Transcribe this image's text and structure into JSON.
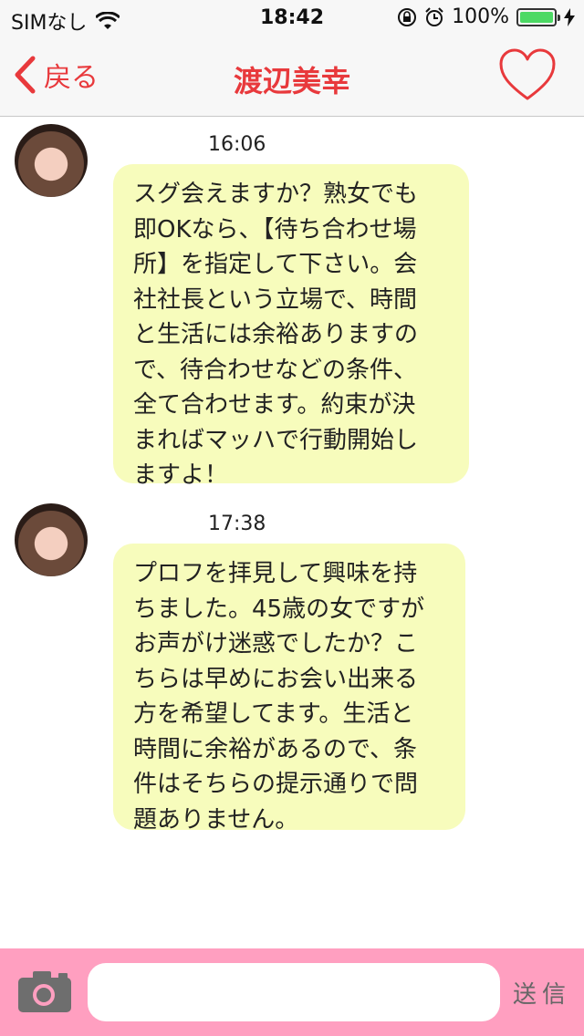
{
  "status_bar": {
    "carrier": "SIMなし",
    "time": "18:42",
    "battery_percent": "100%",
    "battery_level": 1.0,
    "icons": [
      "wifi-icon",
      "rotation-lock-icon",
      "alarm-icon",
      "battery-icon",
      "charging-icon"
    ]
  },
  "nav": {
    "back_label": "戻る",
    "title": "渡辺美幸",
    "accent_color": "#e8393c"
  },
  "messages": [
    {
      "time": "16:06",
      "lines": [
        "スグ会えますか？熟女でも",
        "即OKなら、【待ち合わせ場",
        "所】を指定して下さい。会",
        "社社長という立場で、時間",
        "と生活には余裕ありますの",
        "で、待合わせなどの条件、",
        "全て合わせます。約束が決",
        "まればマッハで行動開始し",
        "ますよ！"
      ]
    },
    {
      "time": "17:38",
      "lines": [
        "プロフを拝見して興味を持",
        "ちました。45歳の女ですが",
        "お声がけ迷惑でしたか？こ",
        "ちらは早めにお会い出来る",
        "方を希望してます。生活と",
        "時間に余裕があるので、条",
        "件はそちらの提示通りで問",
        "題ありません。"
      ]
    }
  ],
  "input_bar": {
    "input_value": "",
    "send_label": "送信",
    "background_color": "#ff9fc0",
    "bubble_color": "#f7fcbc"
  }
}
